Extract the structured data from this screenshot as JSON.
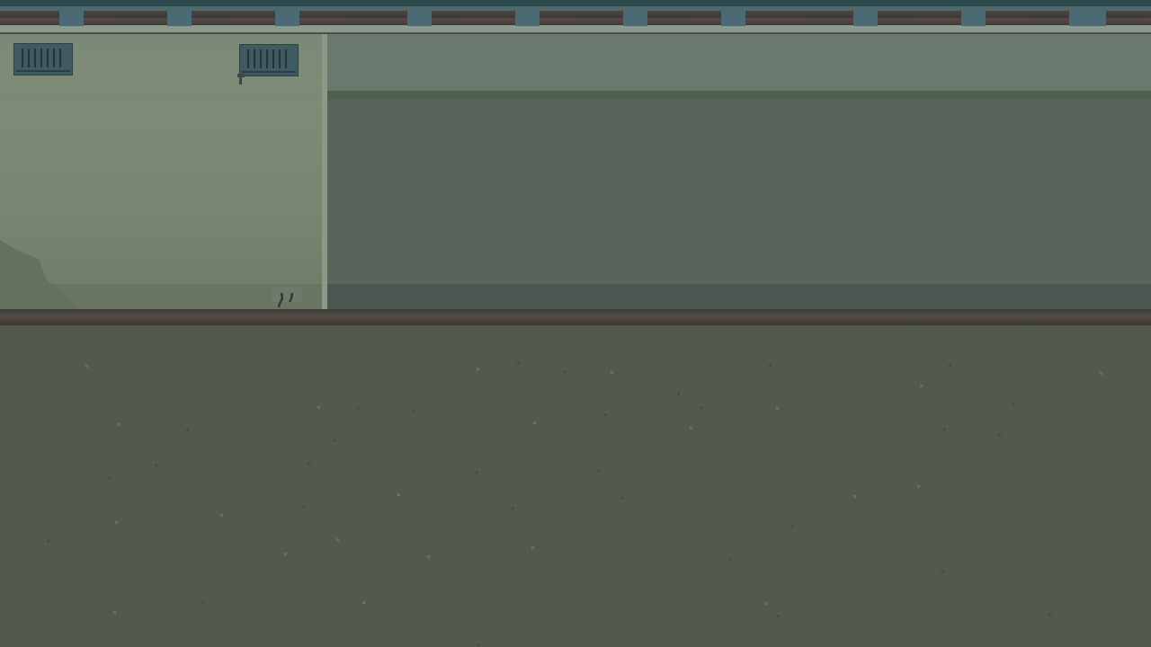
{
  "scene": {
    "colors": {
      "ceiling": "#2c4a4c",
      "rail_bracket": "#4c6a74",
      "left_room_wall": "#7a8a78",
      "right_room_wall": "#5a645a",
      "ground": "#53594d",
      "vent": "#3f5a60"
    },
    "objects": [
      "ceiling-rail",
      "ventilation-grille",
      "ventilation-grille",
      "room-divider-pillar",
      "floor-track",
      "player-character"
    ]
  }
}
